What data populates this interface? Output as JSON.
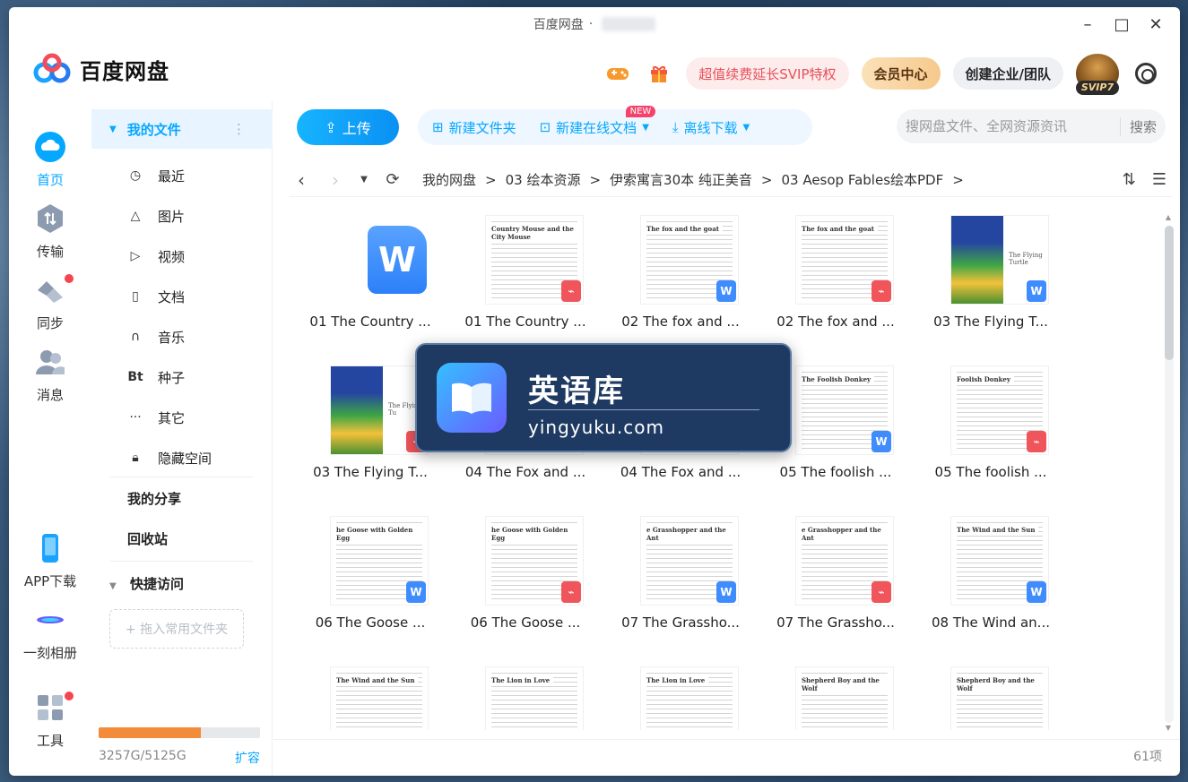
{
  "window": {
    "title": "百度网盘",
    "title_sep": "·",
    "controls": [
      "–",
      "□",
      "✕"
    ]
  },
  "header": {
    "logo_text": "百度网盘",
    "promo_label": "超值续费延长SVIP特权",
    "vip_center_label": "会员中心",
    "corp_label": "创建企业/团队",
    "svip_badge": "SVIP7"
  },
  "rail": [
    {
      "label": "首页",
      "icon": "cloud-icon",
      "active": true
    },
    {
      "label": "传输",
      "icon": "transfer-icon"
    },
    {
      "label": "同步",
      "icon": "sync-icon",
      "dot": true
    },
    {
      "label": "消息",
      "icon": "message-icon"
    },
    {
      "label": "APP下载",
      "icon": "phone-icon"
    },
    {
      "label": "一刻相册",
      "icon": "album-icon"
    },
    {
      "label": "工具",
      "icon": "tools-icon",
      "dot": true
    }
  ],
  "sidebar": {
    "my_files": "我的文件",
    "items": [
      {
        "label": "最近",
        "icon": "clock-icon"
      },
      {
        "label": "图片",
        "icon": "image-icon"
      },
      {
        "label": "视频",
        "icon": "video-icon"
      },
      {
        "label": "文档",
        "icon": "document-icon"
      },
      {
        "label": "音乐",
        "icon": "music-icon"
      },
      {
        "label": "种子",
        "icon": "torrent-icon"
      },
      {
        "label": "其它",
        "icon": "more-icon"
      },
      {
        "label": "隐藏空间",
        "icon": "lock-icon"
      }
    ],
    "my_share": "我的分享",
    "recycle": "回收站",
    "quick_access": "快捷访问",
    "drop_folder": "+ 拖入常用文件夹",
    "quota_text": "3257G/5125G",
    "quota_used_fraction": 0.636,
    "expand_label": "扩容"
  },
  "toolbar": {
    "upload": "上传",
    "new_folder": "新建文件夹",
    "new_online_doc": "新建在线文档",
    "new_badge": "NEW",
    "offline_download": "离线下载",
    "search_placeholder": "搜网盘文件、全网资源资讯",
    "search_button": "搜索"
  },
  "path": {
    "crumbs": [
      "我的网盘",
      "03 绘本资源",
      "伊索寓言30本 纯正美音",
      "03 Aesop Fables绘本PDF"
    ],
    "sep": ">"
  },
  "files": [
    {
      "name": "01 The Country ...",
      "type": "word-large"
    },
    {
      "name": "01 The Country ...",
      "type": "pdf",
      "thumb_title": "Country Mouse and the City Mouse"
    },
    {
      "name": "02 The fox and ...",
      "type": "word",
      "thumb_title": "The fox and the goat"
    },
    {
      "name": "02 The fox and ...",
      "type": "pdf",
      "thumb_title": "The fox and the goat"
    },
    {
      "name": "03 The Flying T...",
      "type": "word-cover",
      "thumb_title": "The Flying Turtle"
    },
    {
      "name": "03 The Flying T...",
      "type": "pdf-cover",
      "thumb_title": "The Flying Tu"
    },
    {
      "name": "04 The Fox and ...",
      "type": "word",
      "thumb_title": ""
    },
    {
      "name": "04 The Fox and ...",
      "type": "pdf",
      "thumb_title": ""
    },
    {
      "name": "05 The foolish ...",
      "type": "word",
      "thumb_title": "The Foolish Donkey"
    },
    {
      "name": "05 The foolish ...",
      "type": "pdf",
      "thumb_title": "Foolish Donkey"
    },
    {
      "name": "06 The Goose ...",
      "type": "word",
      "thumb_title": "he Goose with Golden Egg"
    },
    {
      "name": "06 The Goose ...",
      "type": "pdf",
      "thumb_title": "he Goose with Golden Egg"
    },
    {
      "name": "07 The Grassho...",
      "type": "word",
      "thumb_title": "e Grasshopper and the Ant"
    },
    {
      "name": "07 The Grassho...",
      "type": "pdf",
      "thumb_title": "e Grasshopper and the Ant"
    },
    {
      "name": "08 The Wind an...",
      "type": "word",
      "thumb_title": "The Wind and the Sun"
    },
    {
      "name": "",
      "type": "doc",
      "thumb_title": "The Wind and the Sun"
    },
    {
      "name": "",
      "type": "doc",
      "thumb_title": "The Lion in Love"
    },
    {
      "name": "",
      "type": "doc",
      "thumb_title": "The Lion in Love"
    },
    {
      "name": "",
      "type": "doc",
      "thumb_title": "Shepherd Boy and the Wolf"
    },
    {
      "name": "",
      "type": "doc",
      "thumb_title": "Shepherd Boy and the Wolf"
    }
  ],
  "status": {
    "count": "61项"
  },
  "watermark": {
    "title": "英语库",
    "subtitle": "yingyuku.com"
  },
  "colors": {
    "accent": "#06a7ff",
    "pdf": "#f1555c",
    "word": "#3f8cff",
    "quota": "#f28b3a"
  }
}
